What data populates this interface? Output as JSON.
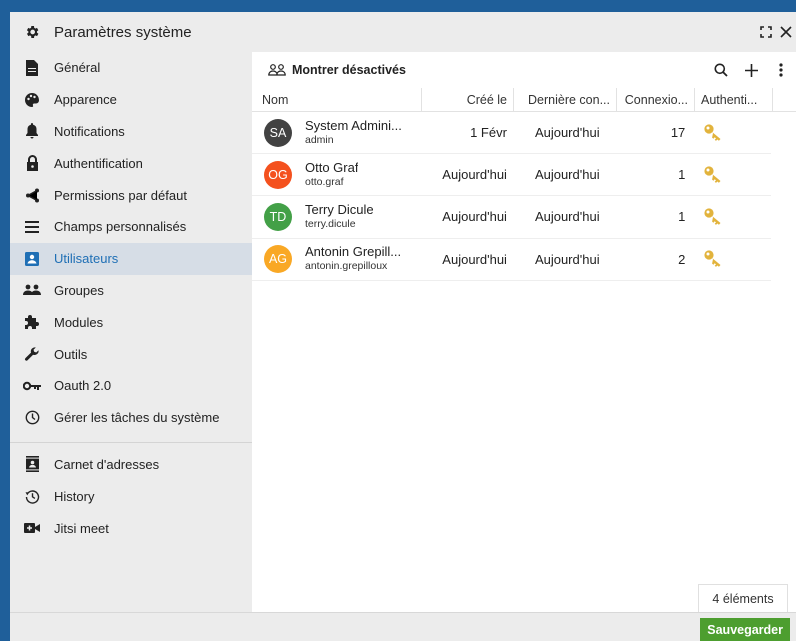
{
  "window": {
    "title": "Paramètres système"
  },
  "sidebar": {
    "items": [
      {
        "label": "Général",
        "icon": "document-icon"
      },
      {
        "label": "Apparence",
        "icon": "palette-icon"
      },
      {
        "label": "Notifications",
        "icon": "bell-icon"
      },
      {
        "label": "Authentification",
        "icon": "lock-icon"
      },
      {
        "label": "Permissions par défaut",
        "icon": "share-icon"
      },
      {
        "label": "Champs personnalisés",
        "icon": "list-icon"
      },
      {
        "label": "Utilisateurs",
        "icon": "user-card-icon",
        "active": true
      },
      {
        "label": "Groupes",
        "icon": "group-icon"
      },
      {
        "label": "Modules",
        "icon": "puzzle-icon"
      },
      {
        "label": "Outils",
        "icon": "wrench-icon"
      },
      {
        "label": "Oauth 2.0",
        "icon": "key-icon"
      },
      {
        "label": "Gérer les tâches du système",
        "icon": "clock-icon"
      }
    ],
    "extra_items": [
      {
        "label": "Carnet d'adresses",
        "icon": "contacts-icon"
      },
      {
        "label": "History",
        "icon": "history-icon"
      },
      {
        "label": "Jitsi meet",
        "icon": "video-icon"
      }
    ]
  },
  "toolbar": {
    "show_disabled": "Montrer désactivés"
  },
  "table": {
    "columns": [
      "Nom",
      "Créé le",
      "Dernière con...",
      "Connexio...",
      "Authenti..."
    ],
    "rows": [
      {
        "initials": "SA",
        "color": "#424242",
        "name": "System Admini...",
        "login": "admin",
        "created": "1 Févr",
        "last_login": "Aujourd'hui",
        "logins": "17"
      },
      {
        "initials": "OG",
        "color": "#f4511e",
        "name": "Otto Graf",
        "login": "otto.graf",
        "created": "Aujourd'hui",
        "last_login": "Aujourd'hui",
        "logins": "1"
      },
      {
        "initials": "TD",
        "color": "#43a047",
        "name": "Terry Dicule",
        "login": "terry.dicule",
        "created": "Aujourd'hui",
        "last_login": "Aujourd'hui",
        "logins": "1"
      },
      {
        "initials": "AG",
        "color": "#f9a825",
        "name": "Antonin Grepill...",
        "login": "antonin.grepilloux",
        "created": "Aujourd'hui",
        "last_login": "Aujourd'hui",
        "logins": "2"
      }
    ]
  },
  "count_label": "4 éléments",
  "footer": {
    "save_label": "Sauvegarder"
  },
  "colors": {
    "accent": "#1f6fb5",
    "save": "#4d9e2f",
    "key": "#e2b33c",
    "frame": "#1f5f9a"
  }
}
